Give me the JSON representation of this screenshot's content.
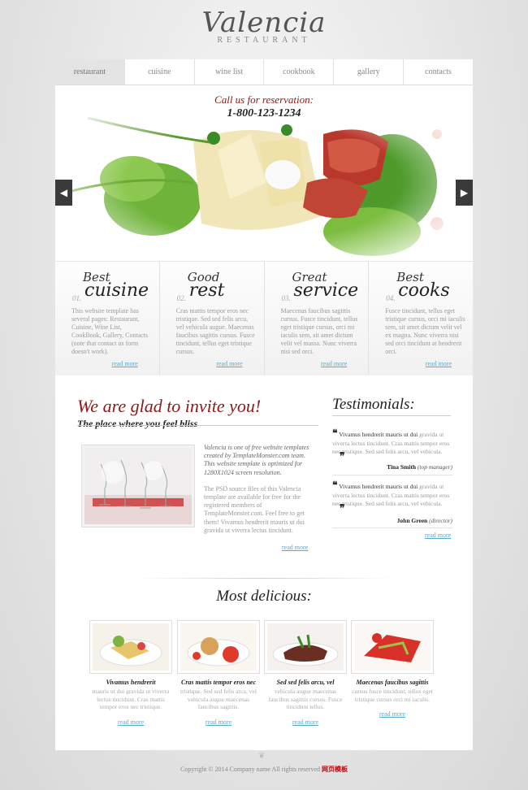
{
  "logo": {
    "name": "Valencia",
    "subtitle": "RESTAURANT"
  },
  "nav": [
    {
      "label": "restaurant",
      "active": true
    },
    {
      "label": "cuisine"
    },
    {
      "label": "wine list"
    },
    {
      "label": "cookbook"
    },
    {
      "label": "gallery"
    },
    {
      "label": "contacts"
    }
  ],
  "slider": {
    "reservation_label": "Call us for reservation:",
    "phone": "1-800-123-1234",
    "prev_icon": "chevron-left-icon",
    "next_icon": "chevron-right-icon"
  },
  "features": [
    {
      "num": "01.",
      "word1": "Best",
      "word2": "cuisine",
      "text": "This website template has several pages: Restaurant, Cuisine, Wine List, CookBook, Gallery, Contacts (note that contact us form doesn't work).",
      "more": "read more"
    },
    {
      "num": "02.",
      "word1": "Good",
      "word2": "rest",
      "text": "Cras mattis tempor eros nec tristique. Sed sed felis arcu, vel vehicula augue. Maecenas faucibus sagittis cursus. Fusce tincidunt, tellus eget tristique cursus.",
      "more": "read more"
    },
    {
      "num": "03.",
      "word1": "Great",
      "word2": "service",
      "text": "Maecenas faucibus sagittis cursus. Fusce tincidunt, tellus eget tristique cursus, orci mi iaculis sem, sit amet dictum velit vel massa. Nunc viverra nisi sed orci.",
      "more": "read more"
    },
    {
      "num": "04.",
      "word1": "Best",
      "word2": "cooks",
      "text": "Fusce tincidunt, tellus eget tristique cursus, orci mi iaculis sem, sit amet dictum velit vel ex magna. Nunc viverra nisi sed orci tincidunt at hendrerit orci.",
      "more": "read more"
    }
  ],
  "invite": {
    "title": "We are glad to invite you!",
    "subtitle": "The place where you feel bliss",
    "para1": "Valencia is one of free website templates created by TemplateMonster.com team. This website template is optimized for 1280X1024 screen resolution.",
    "para2": "The PSD source files of this Valencia template are available for free for the registered members of TemplateMonster.com. Feel free to get them! Vivamus hendrerit mauris ut dui gravida ut viverra lectus tincidunt.",
    "more": "read more"
  },
  "testimonials": {
    "title": "Testimonials:",
    "items": [
      {
        "lead": "Vivamus hendrerit mauris ut dui",
        "text": "gravida ut viverra lectus tincidunt. Cras mattis tempor eros nec tristique. Sed sed felis arcu, vel vehicula.",
        "author": "Tina Smith",
        "role": "(top manager)"
      },
      {
        "lead": "Vivamus hendrerit mauris ut dui",
        "text": "gravida ut viverra lectus tincidunt. Cras mattis tempor eros nec tristique. Sed sed felis arcu, vel vehicula.",
        "author": "John Green",
        "role": "(director)"
      }
    ],
    "more": "read more"
  },
  "most_delicious": {
    "title": "Most delicious:",
    "items": [
      {
        "name": "Vivamus hendrerit",
        "text": "mauris ut dui gravida ut viverra lectus tincidunt. Cras mattis tempor eros nec tristique.",
        "more": "read more"
      },
      {
        "name": "Cras mattis tempor eros nec",
        "text": "tristique. Sed sed felis arcu, vel vehicula augue maecenas faucibus sagittis.",
        "more": "read more"
      },
      {
        "name": "Sed sed felis arcu, vel",
        "text": "vehicula augue maecenas faucibus sagittis cursus. Fusce tincidunt tellus.",
        "more": "read more"
      },
      {
        "name": "Maecenas faucibus sagittis",
        "text": "cursus fusce tincidunt, tellus eget tristique cursus orci mi iaculis.",
        "more": "read more"
      }
    ]
  },
  "footer": {
    "copyright": "Copyright © 2014 Company name All rights reserved",
    "badge": "网页模板"
  },
  "colors": {
    "accent_red": "#8b1a1a",
    "link": "#5aa9c9",
    "nav_active": "#e4e4e4"
  }
}
